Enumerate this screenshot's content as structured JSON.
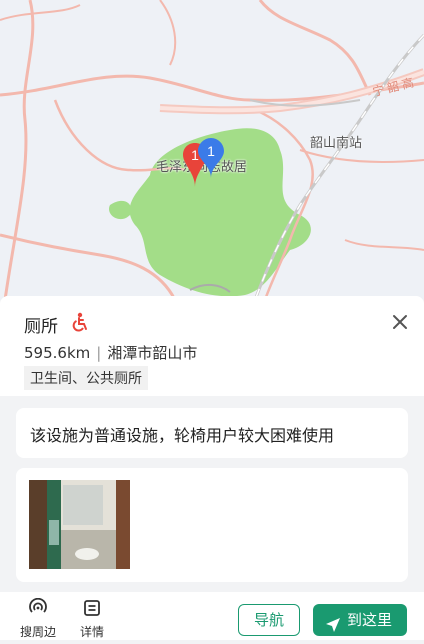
{
  "map": {
    "labels": {
      "residence": "毛泽东同志故居",
      "station": "韶山南站",
      "railway": "宁韶高"
    },
    "markers": [
      {
        "number": "1",
        "color": "#e8443a"
      },
      {
        "number": "1",
        "color": "#3b7be8"
      }
    ],
    "colors": {
      "park": "#9fdc84",
      "road": "#f3b8ad",
      "water": "#eef1f6"
    }
  },
  "place": {
    "title": "厕所",
    "accessibility_icon": "wheelchair-icon",
    "distance": "595.6km",
    "city": "湘潭市韶山市",
    "category": "卫生间、公共厕所",
    "notice": "该设施为普通设施，轮椅用户较大困难使用"
  },
  "bottom_bar": {
    "search_nearby": "搜周边",
    "details": "详情",
    "navigate": "导航",
    "go_here": "到这里"
  },
  "accent_color": "#1a9a70"
}
